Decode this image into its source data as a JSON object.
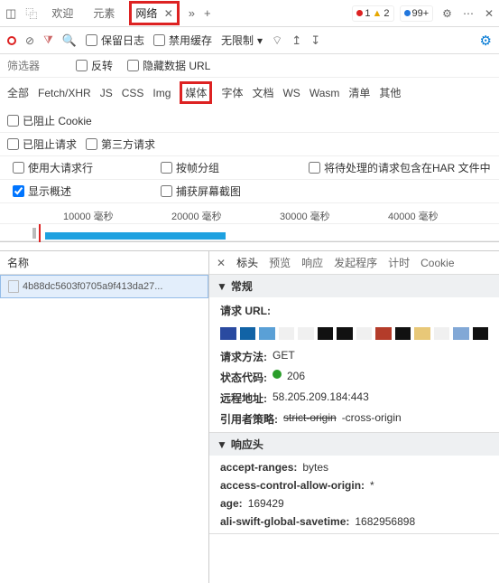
{
  "top_tabs": {
    "welcome": "欢迎",
    "elements": "元素",
    "network": "网络"
  },
  "badges": {
    "red": "1",
    "yellow": "2",
    "blue": "99+"
  },
  "toolbar": {
    "keep_log": "保留日志",
    "disable_cache": "禁用缓存",
    "throttle": "无限制"
  },
  "filter": {
    "placeholder": "筛选器",
    "invert": "反转",
    "hide_data_url": "隐藏数据 URL"
  },
  "types": {
    "all": "全部",
    "fetch": "Fetch/XHR",
    "js": "JS",
    "css": "CSS",
    "img": "Img",
    "media": "媒体",
    "font": "字体",
    "doc": "文档",
    "ws": "WS",
    "wasm": "Wasm",
    "manifest": "清单",
    "other": "其他",
    "blocked_cookie": "已阻止 Cookie",
    "blocked_requests": "已阻止请求",
    "third_party": "第三方请求"
  },
  "options": {
    "large_rows": "使用大请求行",
    "group_frame": "按帧分组",
    "include_har": "将待处理的请求包含在HAR 文件中",
    "show_overview": "显示概述",
    "capture_screenshot": "捕获屏幕截图"
  },
  "timeline": {
    "t1": "10000 毫秒",
    "t2": "20000 毫秒",
    "t3": "30000 毫秒",
    "t4": "40000 毫秒"
  },
  "left": {
    "header": "名称",
    "item": "4b88dc5603f0705a9f413da27..."
  },
  "right_tabs": {
    "headers": "标头",
    "preview": "预览",
    "response": "响应",
    "initiator": "发起程序",
    "timing": "计时",
    "cookie": "Cookie"
  },
  "general": {
    "title": "常规",
    "url_k": "请求 URL:",
    "method_k": "请求方法:",
    "method_v": "GET",
    "status_k": "状态代码:",
    "status_v": "206",
    "remote_k": "远程地址:",
    "remote_v": "58.205.209.184:443",
    "ref_k": "引用者策略:",
    "ref_v_strike": "strict-origin",
    "ref_v_tail": "-cross-origin"
  },
  "resp": {
    "title": "响应头",
    "r1k": "accept-ranges:",
    "r1v": "bytes",
    "r2k": "access-control-allow-origin:",
    "r2v": "*",
    "r3k": "age:",
    "r3v": "169429",
    "r4k": "ali-swift-global-savetime:",
    "r4v": "1682956898"
  },
  "colors": [
    "#2a4aa0",
    "#1163a6",
    "#5aa0d6",
    "#f0f0f0",
    "#f0f0f0",
    "#111",
    "#111",
    "#f0f0f0",
    "#b43c2a",
    "#111",
    "#e8c878",
    "#f0f0f0",
    "#82a8d6",
    "#111"
  ]
}
